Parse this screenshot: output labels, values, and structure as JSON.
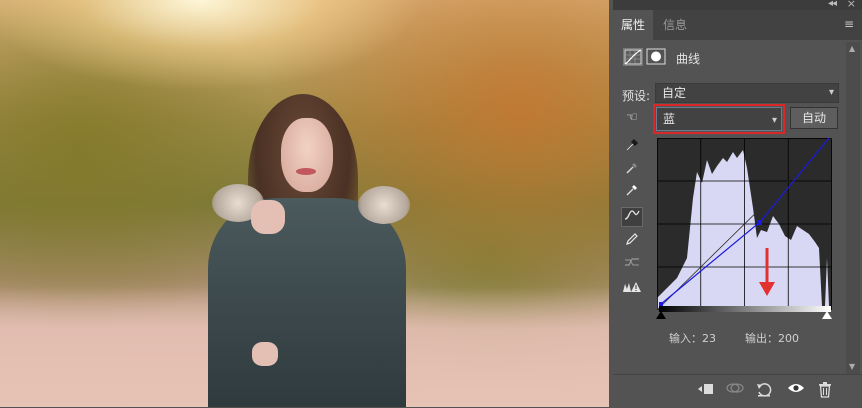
{
  "panel": {
    "collapse_icon": "double-chevron-right-icon",
    "menu_icon": "panel-menu-icon",
    "tabs": [
      {
        "label": "属性",
        "active": true
      },
      {
        "label": "信息",
        "active": false
      }
    ]
  },
  "adjustment": {
    "type_icon": "curves-adjustment-icon",
    "mask_icon": "layer-mask-icon",
    "title": "曲线"
  },
  "preset": {
    "label": "预设:",
    "value": "自定"
  },
  "channel": {
    "value": "蓝",
    "highlight_color": "#d9272a"
  },
  "auto_button": {
    "label": "自动"
  },
  "tools": [
    {
      "name": "on-image-adjust-icon",
      "glyph": "☜"
    },
    {
      "name": "black-point-eyedropper-icon",
      "glyph": "✎"
    },
    {
      "name": "gray-point-eyedropper-icon",
      "glyph": "✎"
    },
    {
      "name": "white-point-eyedropper-icon",
      "glyph": "✎"
    },
    {
      "name": "curve-points-icon",
      "glyph": "∿"
    },
    {
      "name": "pencil-draw-icon",
      "glyph": "✐"
    },
    {
      "name": "smooth-curve-icon",
      "glyph": "≈"
    },
    {
      "name": "clipping-warning-icon",
      "glyph": "⚠"
    }
  ],
  "curve": {
    "channel_color": "#1a1adf",
    "histogram_color": "#d8d8f4",
    "annotation_arrow_color": "#e33030"
  },
  "readout": {
    "input_label": "输入：",
    "input_value": "23",
    "output_label": "输出：",
    "output_value": "200"
  },
  "bottom_icons": [
    "clip-to-layer-icon",
    "view-previous-state-icon",
    "reset-adjustments-icon",
    "visibility-eye-icon",
    "trash-icon"
  ]
}
